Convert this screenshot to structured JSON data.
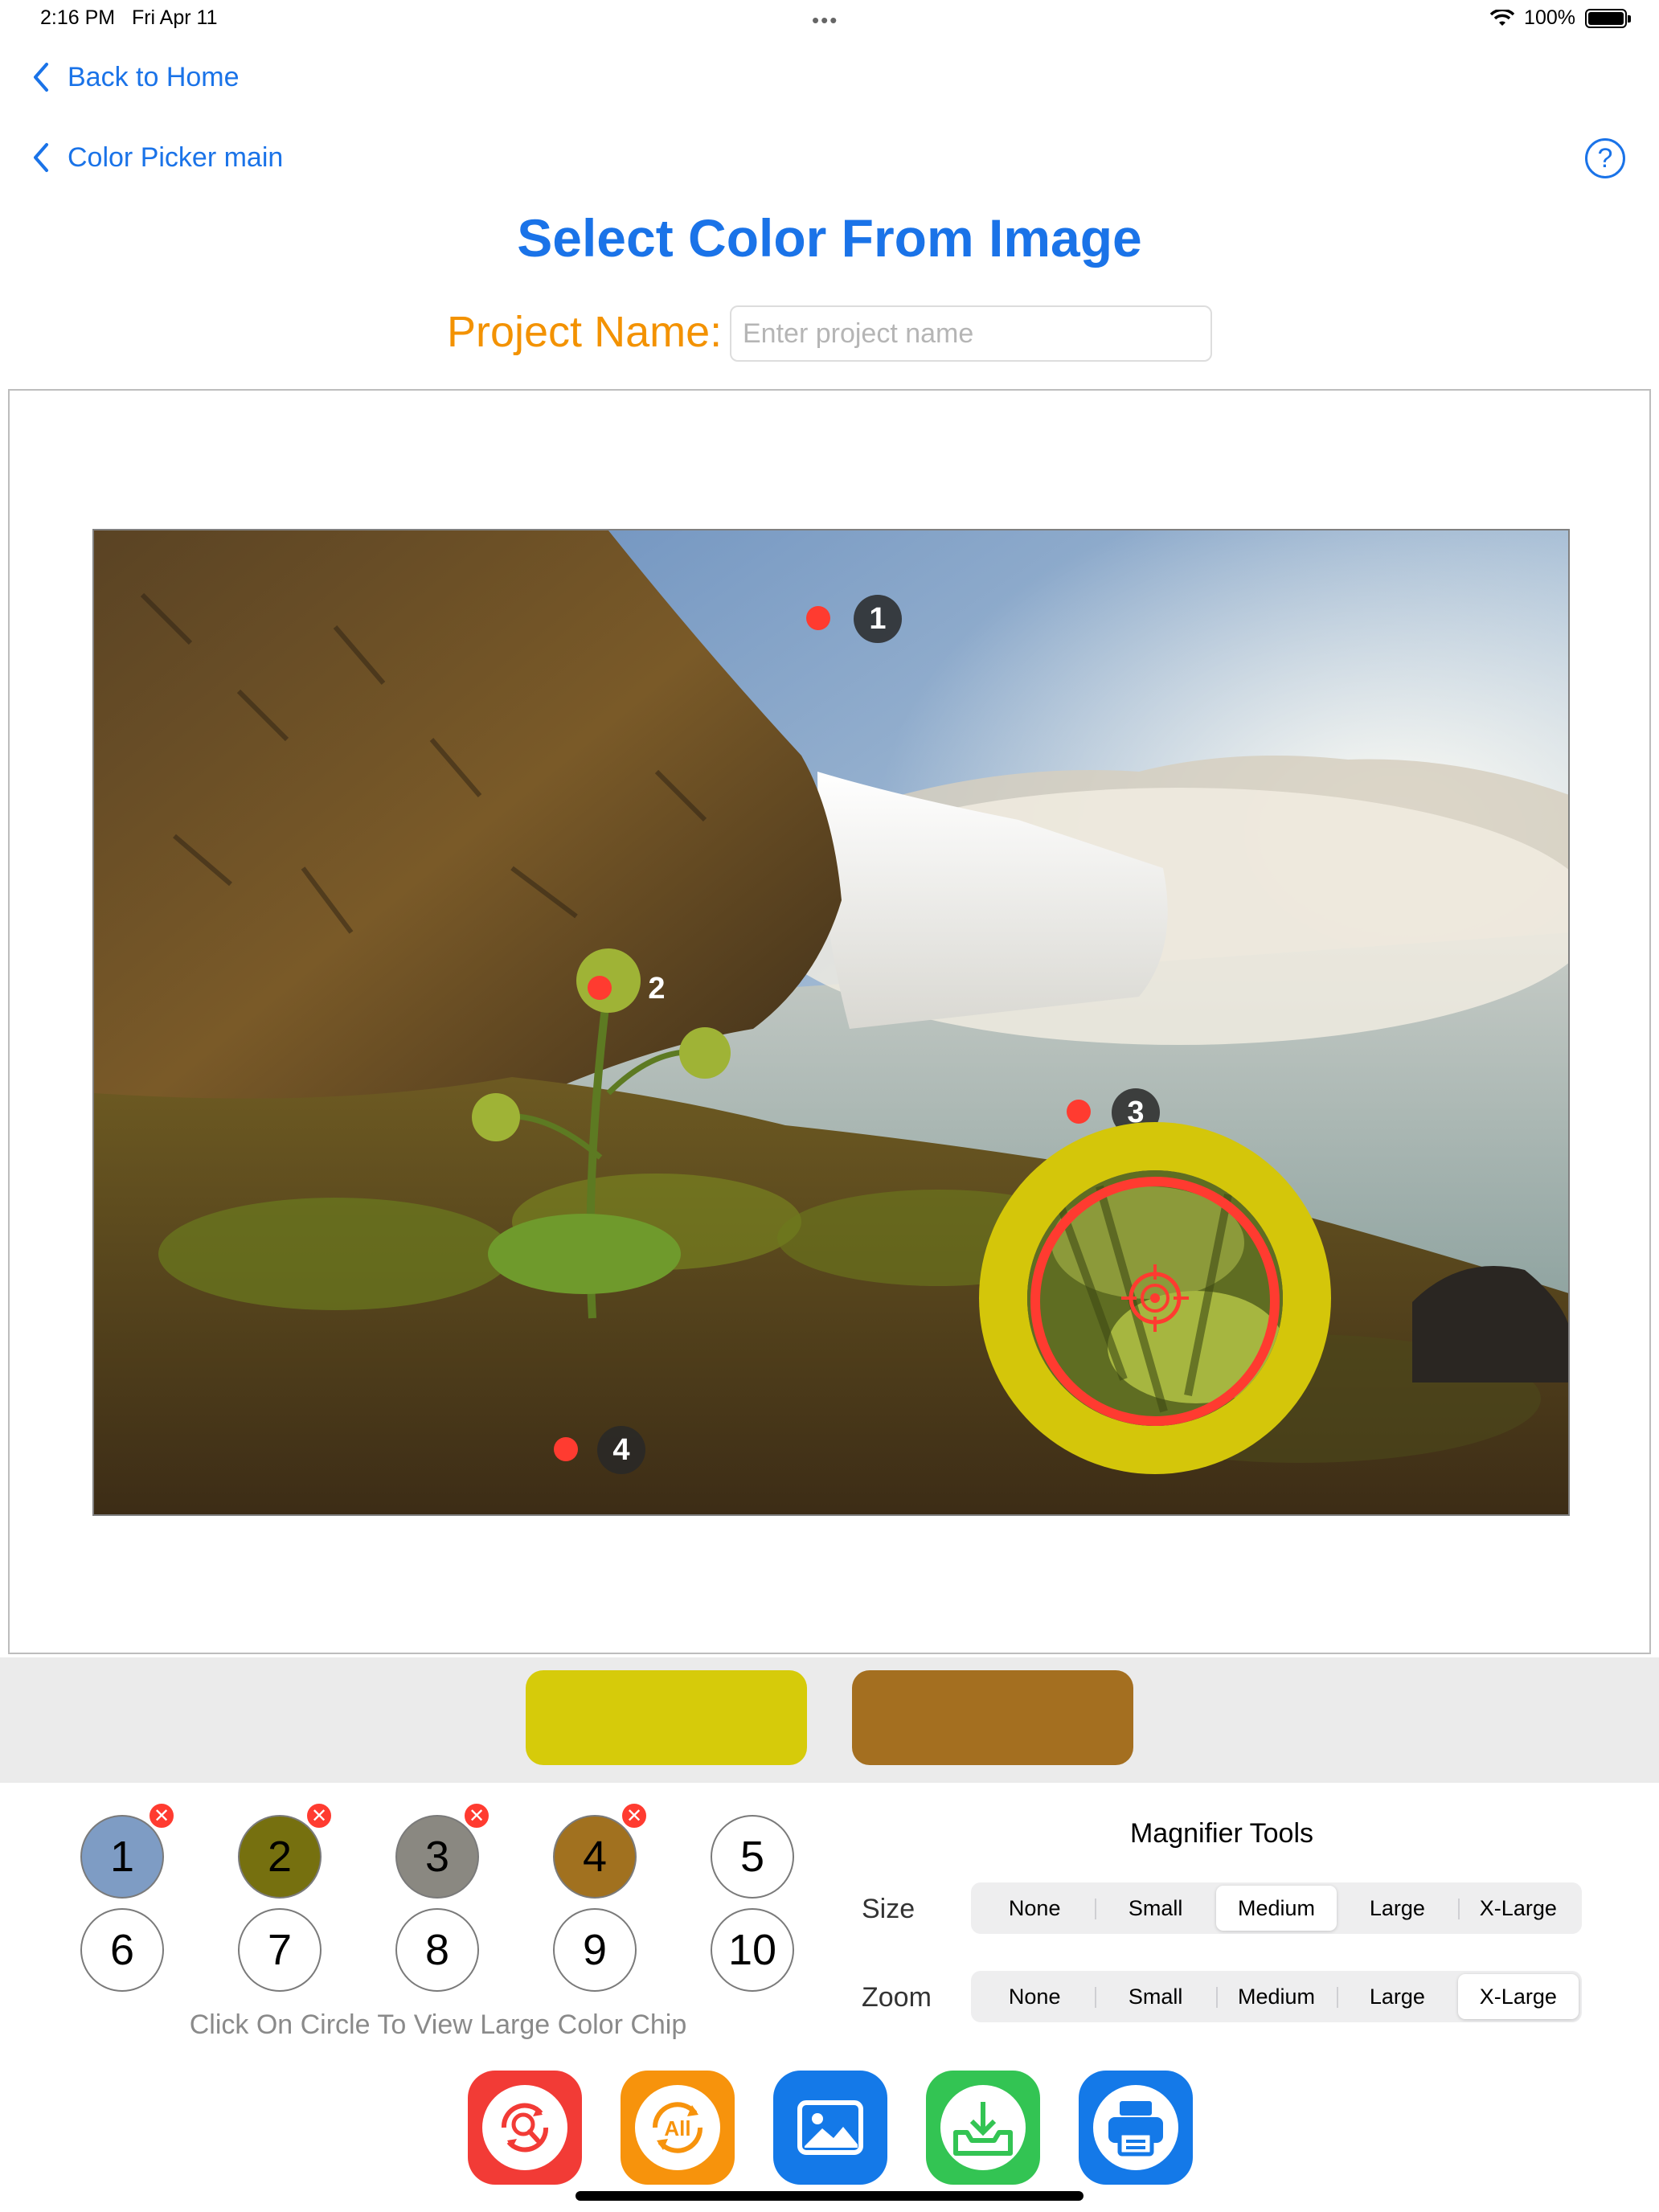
{
  "status_bar": {
    "time": "2:16 PM",
    "date": "Fri Apr 11",
    "battery": "100%",
    "icons": [
      "wifi-icon",
      "battery-icon"
    ]
  },
  "nav": {
    "back_home": "Back to Home",
    "back_picker": "Color Picker main",
    "help": "?"
  },
  "page": {
    "title": "Select Color From Image",
    "project_label": "Project Name:",
    "project_placeholder": "Enter project name",
    "project_value": ""
  },
  "image": {
    "description_icon": "waterfall-photo",
    "markers": [
      "1",
      "2",
      "3",
      "4"
    ],
    "magnifier_color": "#d4c60a"
  },
  "large_chips": [
    {
      "color": "#d6cb0a"
    },
    {
      "color": "#a46f20"
    }
  ],
  "color_circles": [
    {
      "label": "1",
      "color": "#7e9cc4",
      "removable": true
    },
    {
      "label": "2",
      "color": "#76700f",
      "removable": true
    },
    {
      "label": "3",
      "color": "#8a8881",
      "removable": true
    },
    {
      "label": "4",
      "color": "#a1711f",
      "removable": true
    },
    {
      "label": "5",
      "color": "#ffffff",
      "removable": false
    },
    {
      "label": "6",
      "color": "#ffffff",
      "removable": false
    },
    {
      "label": "7",
      "color": "#ffffff",
      "removable": false
    },
    {
      "label": "8",
      "color": "#ffffff",
      "removable": false
    },
    {
      "label": "9",
      "color": "#ffffff",
      "removable": false
    },
    {
      "label": "10",
      "color": "#ffffff",
      "removable": false
    }
  ],
  "hint": "Click On Circle To View Large Color Chip",
  "magnifier_tools": {
    "title": "Magnifier Tools",
    "size_label": "Size",
    "zoom_label": "Zoom",
    "options": [
      "None",
      "Small",
      "Medium",
      "Large",
      "X-Large"
    ],
    "size_selected": "Medium",
    "zoom_selected": "X-Large"
  },
  "actions": [
    {
      "name": "reset-search",
      "icon": "magnify-refresh-icon",
      "color": "#f23b36"
    },
    {
      "name": "all-colors",
      "icon": "all-refresh-icon",
      "text": "All",
      "color": "#f7930c"
    },
    {
      "name": "choose-image",
      "icon": "image-icon",
      "color": "#1479e8"
    },
    {
      "name": "save",
      "icon": "tray-download-icon",
      "color": "#33c453"
    },
    {
      "name": "print",
      "icon": "printer-icon",
      "color": "#1479e8"
    }
  ],
  "colors": {
    "accent": "#1a73e8",
    "orange": "#f39200",
    "red": "#ff3b30"
  }
}
